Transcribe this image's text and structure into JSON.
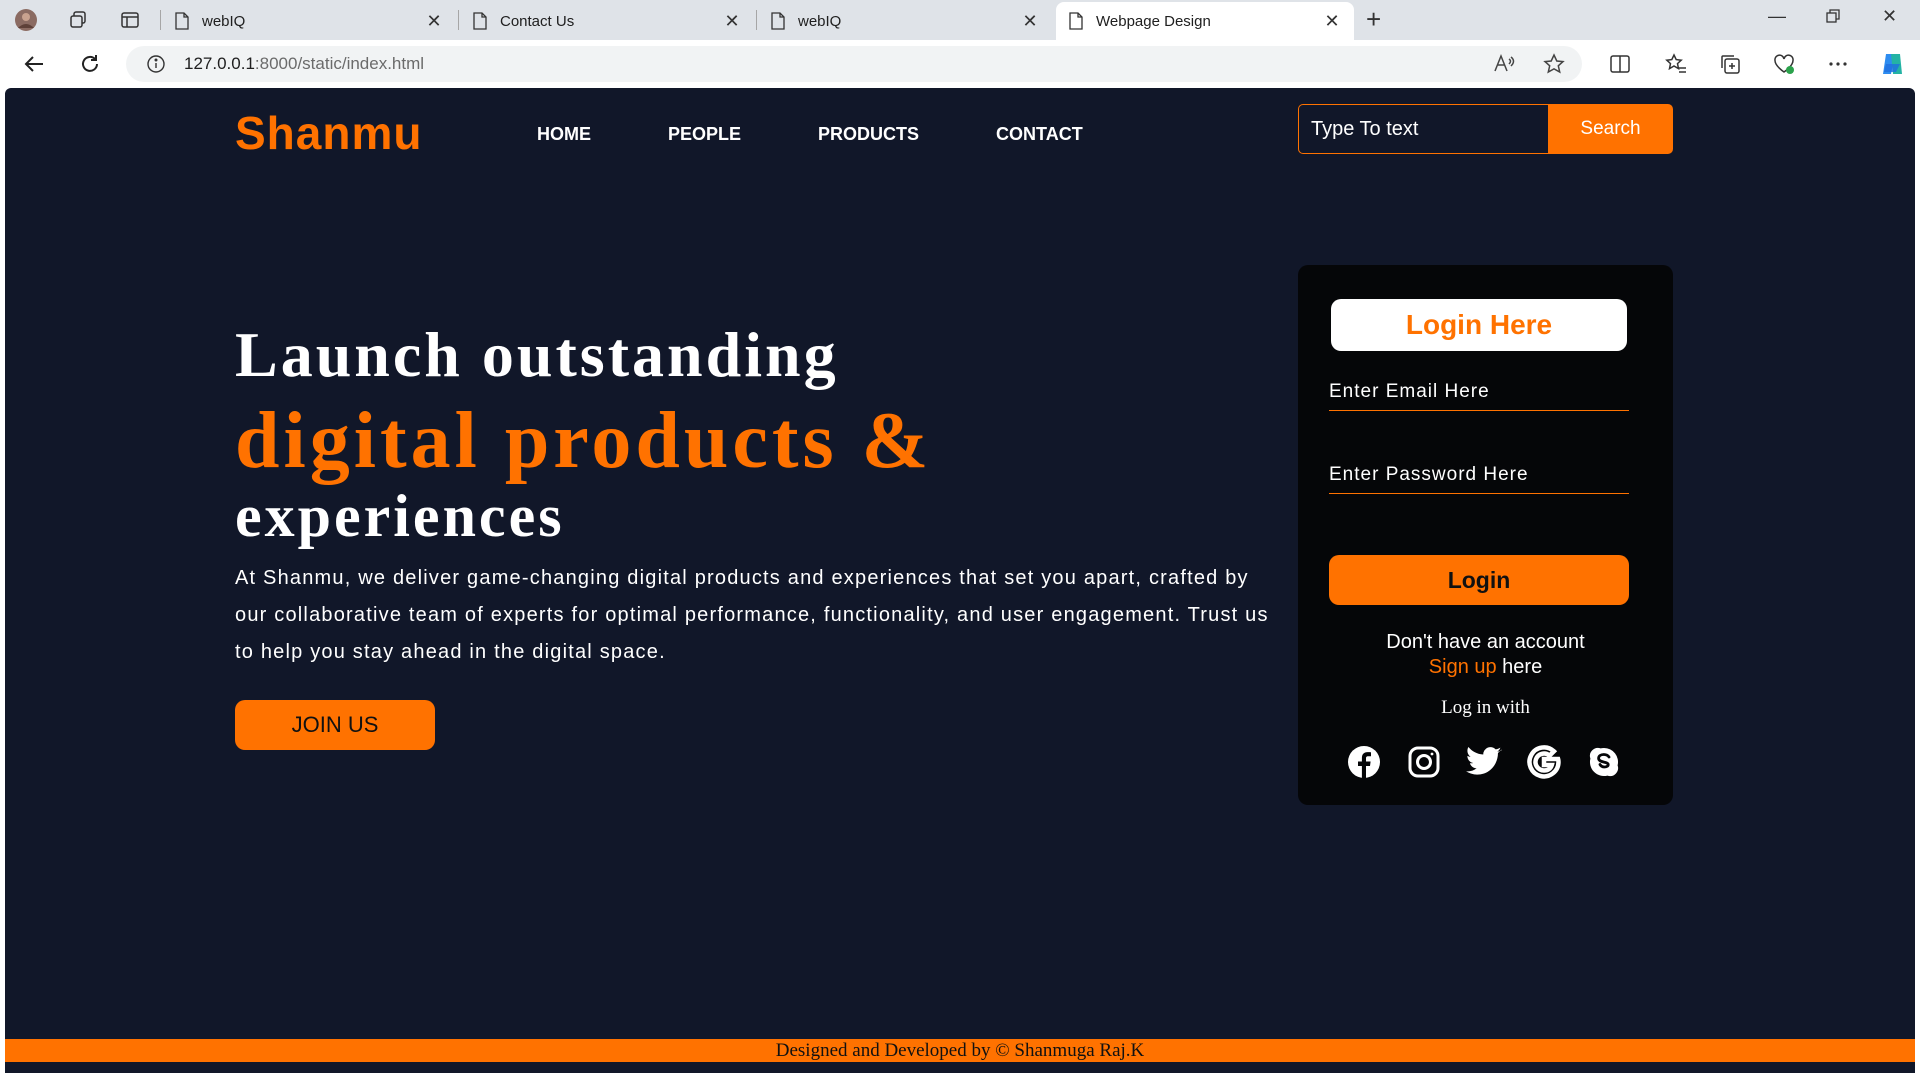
{
  "browser": {
    "tabs": [
      {
        "title": "webIQ",
        "active": false
      },
      {
        "title": "Contact Us",
        "active": false
      },
      {
        "title": "webIQ",
        "active": false
      },
      {
        "title": "Webpage Design",
        "active": true
      }
    ],
    "url_host": "127.0.0.1",
    "url_rest": ":8000/static/index.html"
  },
  "page": {
    "logo": "Shanmu",
    "nav": [
      "HOME",
      "PEOPLE",
      "PRODUCTS",
      "CONTACT"
    ],
    "search": {
      "placeholder": "Type To text",
      "button": "Search"
    },
    "hero": {
      "line1": "Launch outstanding",
      "line2": "digital products &",
      "line3": "experiences",
      "paragraph": "At Shanmu, we deliver game-changing digital products and experiences that set you apart, crafted by our collaborative team of experts for optimal performance, functionality, and user engagement. Trust us to help you stay ahead in the digital space.",
      "cta": "JOIN US"
    },
    "login": {
      "title": "Login Here",
      "email_placeholder": "Enter Email Here",
      "password_placeholder": "Enter Password Here",
      "button": "Login",
      "no_account": "Don't have an account",
      "signup_link": "Sign up",
      "signup_suffix": " here",
      "login_with": "Log in with",
      "socials": [
        "facebook-icon",
        "instagram-icon",
        "twitter-icon",
        "google-icon",
        "skype-icon"
      ]
    },
    "footer": "Designed and Developed by © Shanmuga Raj.K"
  },
  "colors": {
    "accent": "#ff7200",
    "background": "#111729",
    "card": "#050608"
  }
}
